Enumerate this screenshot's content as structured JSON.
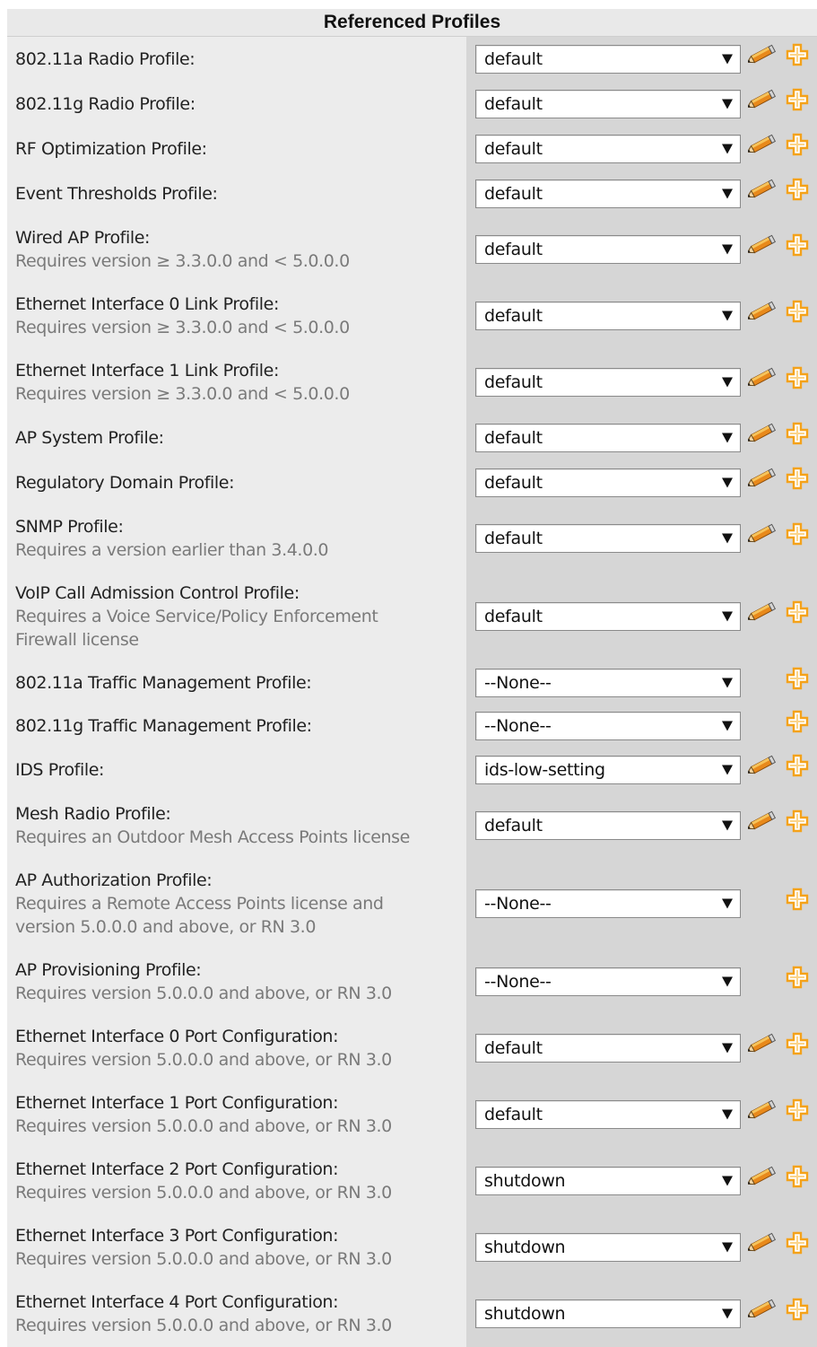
{
  "panel": {
    "title": "Referenced Profiles",
    "rows": [
      {
        "label": "802.11a Radio Profile:",
        "note": "",
        "value": "default",
        "edit": true
      },
      {
        "label": "802.11g Radio Profile:",
        "note": "",
        "value": "default",
        "edit": true
      },
      {
        "label": "RF Optimization Profile:",
        "note": "",
        "value": "default",
        "edit": true
      },
      {
        "label": "Event Thresholds Profile:",
        "note": "",
        "value": "default",
        "edit": true
      },
      {
        "label": "Wired AP Profile:",
        "note": "Requires version ≥ 3.3.0.0 and < 5.0.0.0",
        "value": "default",
        "edit": true
      },
      {
        "label": "Ethernet Interface 0 Link Profile:",
        "note": "Requires version ≥ 3.3.0.0 and < 5.0.0.0",
        "value": "default",
        "edit": true
      },
      {
        "label": "Ethernet Interface 1 Link Profile:",
        "note": "Requires version ≥ 3.3.0.0 and < 5.0.0.0",
        "value": "default",
        "edit": true
      },
      {
        "label": "AP System Profile:",
        "note": "",
        "value": "default",
        "edit": true
      },
      {
        "label": "Regulatory Domain Profile:",
        "note": "",
        "value": "default",
        "edit": true
      },
      {
        "label": "SNMP Profile:",
        "note": "Requires a version earlier than 3.4.0.0",
        "value": "default",
        "edit": true
      },
      {
        "label": "VoIP Call Admission Control Profile:",
        "note": "Requires a Voice Service/Policy Enforcement\nFirewall license",
        "value": "default",
        "edit": true
      },
      {
        "label": "802.11a Traffic Management Profile:",
        "note": "",
        "value": "--None--",
        "edit": false
      },
      {
        "label": "802.11g Traffic Management Profile:",
        "note": "",
        "value": "--None--",
        "edit": false
      },
      {
        "label": "IDS Profile:",
        "note": "",
        "value": "ids-low-setting",
        "edit": true
      },
      {
        "label": "Mesh Radio Profile:",
        "note": "Requires an Outdoor Mesh Access Points license",
        "value": "default",
        "edit": true
      },
      {
        "label": "AP Authorization Profile:",
        "note": "Requires a Remote Access Points license and\nversion 5.0.0.0 and above, or RN 3.0",
        "value": "--None--",
        "edit": false
      },
      {
        "label": "AP Provisioning Profile:",
        "note": "Requires version 5.0.0.0 and above, or RN 3.0",
        "value": "--None--",
        "edit": false
      },
      {
        "label": "Ethernet Interface 0 Port Configuration:",
        "note": "Requires version 5.0.0.0 and above, or RN 3.0",
        "value": "default",
        "edit": true
      },
      {
        "label": "Ethernet Interface 1 Port Configuration:",
        "note": "Requires version 5.0.0.0 and above, or RN 3.0",
        "value": "default",
        "edit": true
      },
      {
        "label": "Ethernet Interface 2 Port Configuration:",
        "note": "Requires version 5.0.0.0 and above, or RN 3.0",
        "value": "shutdown",
        "edit": true
      },
      {
        "label": "Ethernet Interface 3 Port Configuration:",
        "note": "Requires version 5.0.0.0 and above, or RN 3.0",
        "value": "shutdown",
        "edit": true
      },
      {
        "label": "Ethernet Interface 4 Port Configuration:",
        "note": "Requires version 5.0.0.0 and above, or RN 3.0",
        "value": "shutdown",
        "edit": true
      }
    ]
  },
  "icons": {
    "edit": "pencil-icon",
    "add": "plus-icon"
  },
  "colors": {
    "panel_bg": "#d6d6d6",
    "label_bg": "#ececec",
    "note_text": "#7a7a7a",
    "plus_orange": "#f4a21a",
    "pencil_orange": "#e8891b"
  }
}
